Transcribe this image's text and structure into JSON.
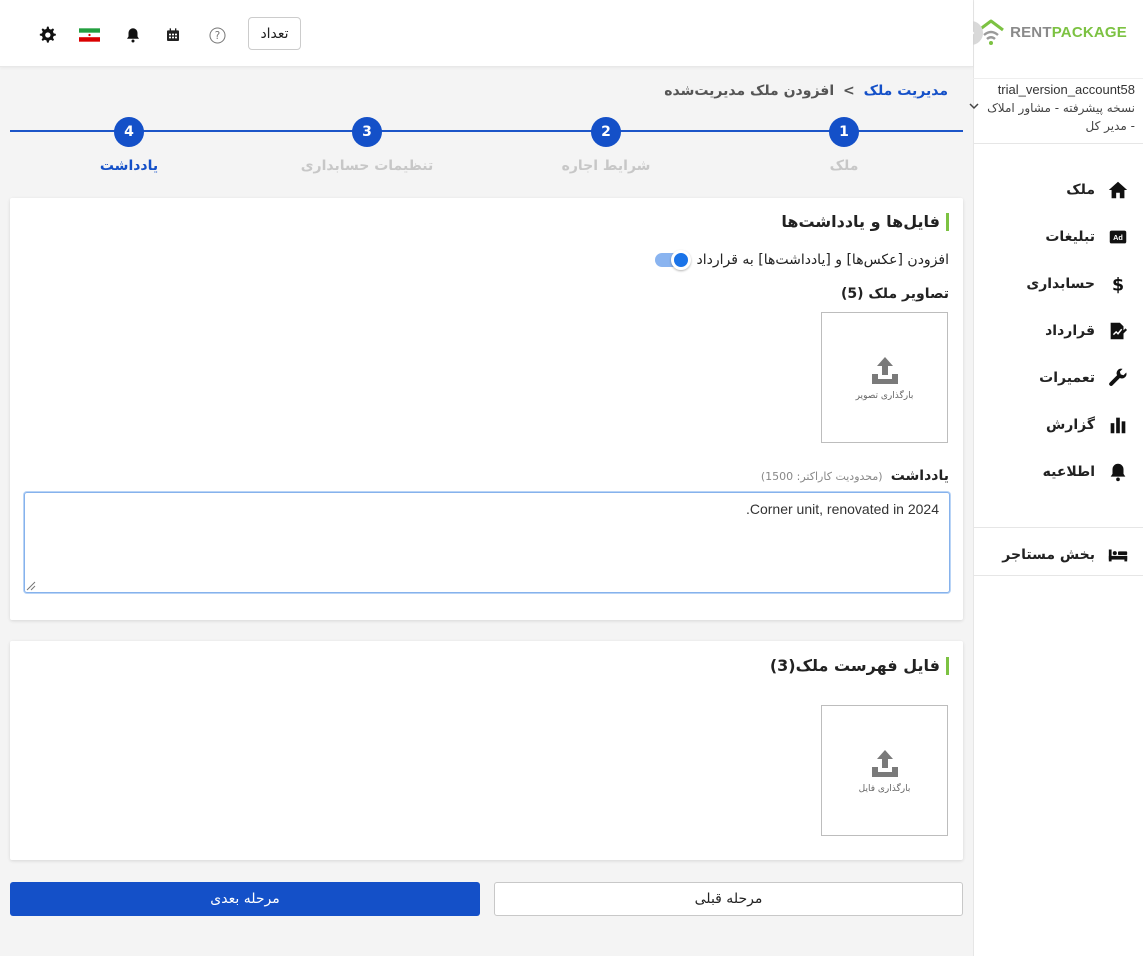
{
  "brand": {
    "logo_rent": "RENT",
    "logo_package": "PACKAGE",
    "accent_green": "#7cc242",
    "accent_blue": "#1450c8"
  },
  "header": {
    "count_button": "تعداد",
    "icons": [
      "settings-icon",
      "iran-flag-icon",
      "bell-icon",
      "calendar-icon",
      "help-icon"
    ]
  },
  "account": {
    "username": "trial_version_account58",
    "role": "نسخه پیشرفته - مشاور املاک - مدیر کل"
  },
  "sidebar": {
    "items": [
      {
        "label": "ملک",
        "icon": "home-icon"
      },
      {
        "label": "تبلیغات",
        "icon": "ad-icon"
      },
      {
        "label": "حسابداری",
        "icon": "dollar-icon"
      },
      {
        "label": "قرارداد",
        "icon": "contract-icon"
      },
      {
        "label": "تعمیرات",
        "icon": "wrench-icon"
      },
      {
        "label": "گزارش",
        "icon": "chart-icon"
      },
      {
        "label": "اطلاعیه",
        "icon": "bell-icon"
      }
    ],
    "tenant_section": {
      "label": "بخش مستاجر",
      "icon": "bed-icon"
    }
  },
  "breadcrumb": {
    "parent": "مدیریت ملک",
    "separator": ">",
    "current": "افزودن ملک مدیریت‌شده"
  },
  "stepper": {
    "steps": [
      {
        "number": "1",
        "label": "ملک"
      },
      {
        "number": "2",
        "label": "شرایط اجاره"
      },
      {
        "number": "3",
        "label": "تنظیمات حسابداری"
      },
      {
        "number": "4",
        "label": "یادداشت"
      }
    ],
    "active_step": "4"
  },
  "files_section": {
    "title": "فایل‌ها و یادداشت‌ها",
    "toggle_label": "افزودن [عکس‌ها] و [یادداشت‌ها] به قرارداد",
    "toggle_on": true,
    "images_label": "تصاویر ملک (5)",
    "upload_image_label": "بارگذاری تصویر",
    "note_label": "یادداشت",
    "note_hint": "(محدودیت کاراکتر: 1500)",
    "note_value": "Corner unit, renovated in 2024."
  },
  "inventory_section": {
    "title": "فایل فهرست ملک(3)",
    "upload_file_label": "بارگذاری فایل"
  },
  "footer": {
    "next_button": "مرحله بعدی",
    "prev_button": "مرحله قبلی"
  }
}
